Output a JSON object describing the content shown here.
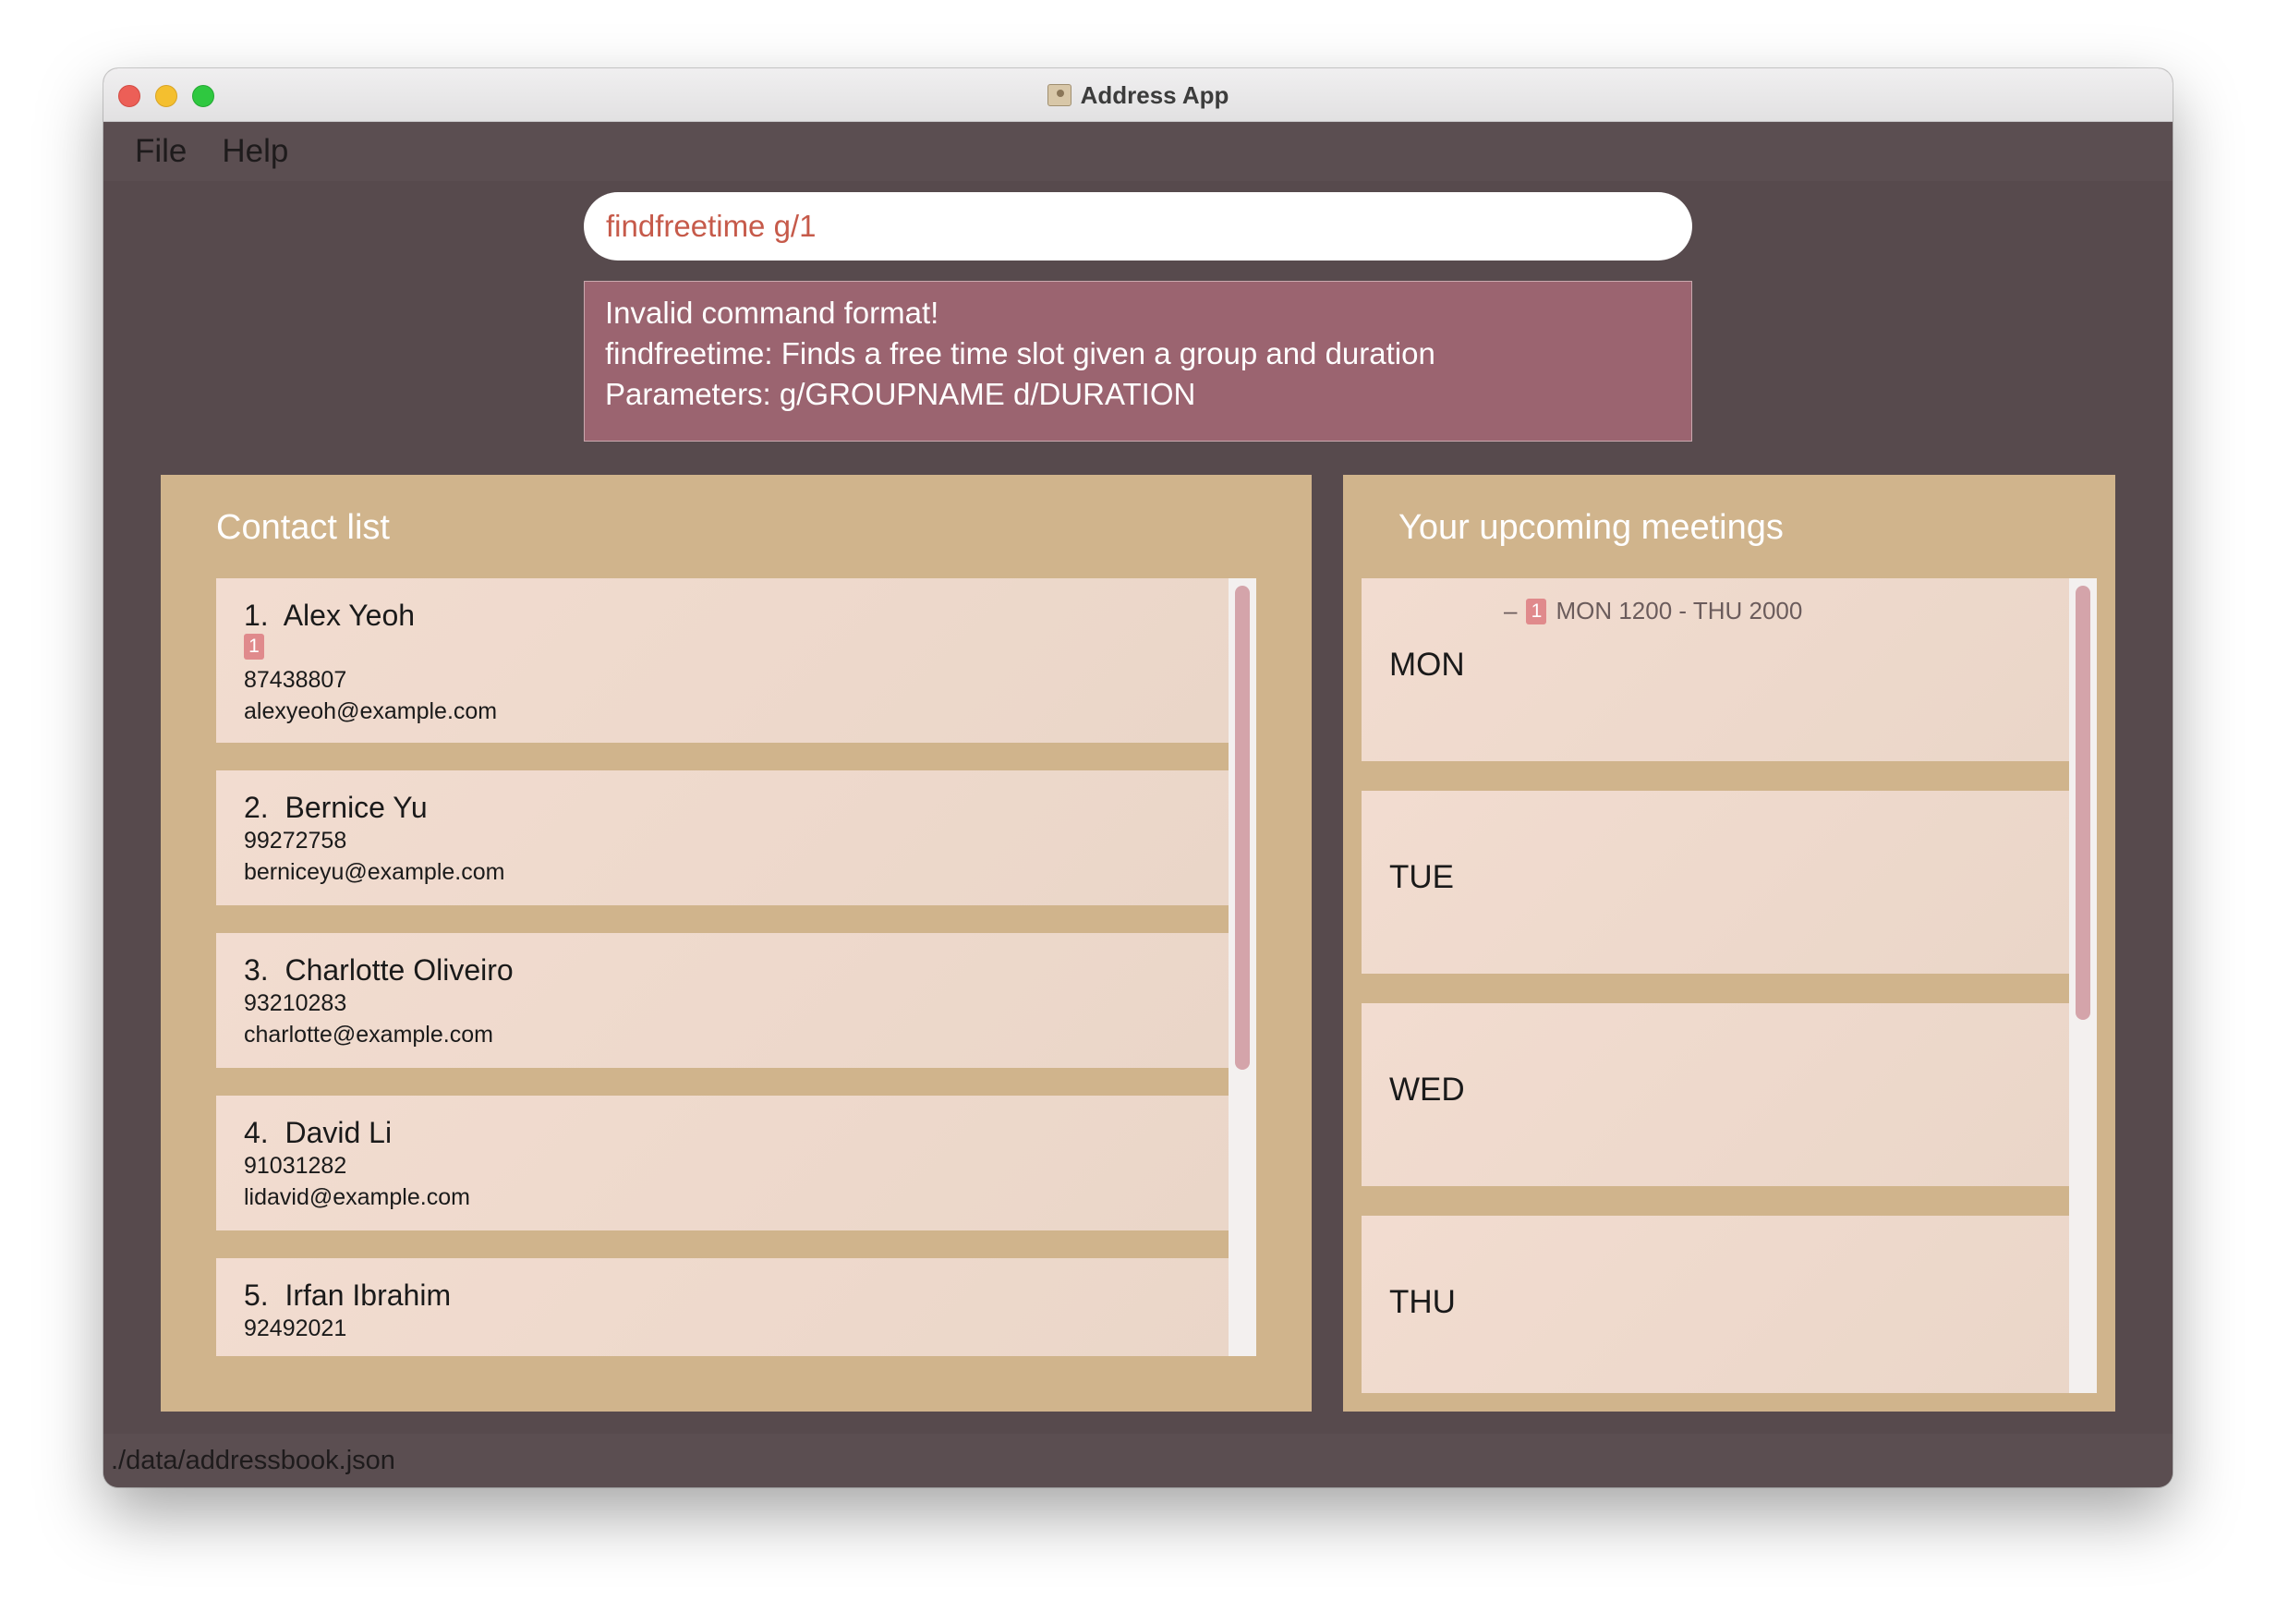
{
  "window": {
    "title": "Address App"
  },
  "menu": [
    "File",
    "Help"
  ],
  "command": {
    "value": "findfreetime g/1"
  },
  "result": {
    "lines": [
      "Invalid command format!",
      "findfreetime: Finds a free time slot given a group and duration",
      "Parameters: g/GROUPNAME d/DURATION"
    ]
  },
  "contacts": {
    "title": "Contact list",
    "items": [
      {
        "index": "1.",
        "name": "Alex Yeoh",
        "tag": "1",
        "phone": "87438807",
        "email": "alexyeoh@example.com"
      },
      {
        "index": "2.",
        "name": "Bernice Yu",
        "phone": "99272758",
        "email": "berniceyu@example.com"
      },
      {
        "index": "3.",
        "name": "Charlotte Oliveiro",
        "phone": "93210283",
        "email": "charlotte@example.com"
      },
      {
        "index": "4.",
        "name": "David Li",
        "phone": "91031282",
        "email": "lidavid@example.com"
      },
      {
        "index": "5.",
        "name": "Irfan Ibrahim",
        "phone": "92492021",
        "email": ""
      }
    ]
  },
  "meetings": {
    "title": "Your upcoming meetings",
    "days": [
      {
        "day": "MON",
        "entries": [
          {
            "dash": "–",
            "tag": "1",
            "time": "MON 1200 - THU 2000"
          }
        ]
      },
      {
        "day": "TUE",
        "entries": []
      },
      {
        "day": "WED",
        "entries": []
      },
      {
        "day": "THU",
        "entries": []
      }
    ]
  },
  "status": {
    "path": "./data/addressbook.json"
  },
  "colors": {
    "window_bg": "#574a4d",
    "panel": "#d0b48c",
    "card": "#f0dccf",
    "result_bg": "#9b6470",
    "command_text": "#c65a4a",
    "tag": "#e08a8c",
    "scroll_thumb": "#d4a4aa"
  }
}
